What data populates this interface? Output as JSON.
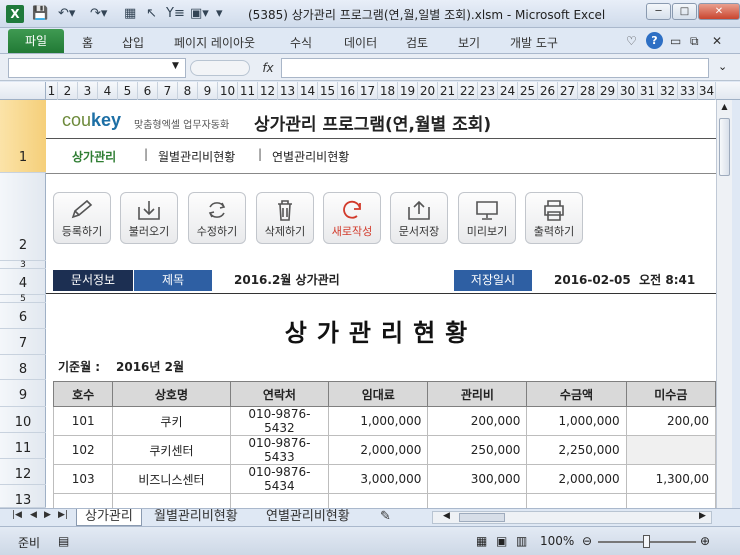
{
  "window": {
    "title": "(5385) 상가관리 프로그램(연,월,일별 조회).xlsm - Microsoft Excel",
    "min": "─",
    "max": "□",
    "close": "✕"
  },
  "ribbon": {
    "tabs": [
      "파일",
      "홈",
      "삽입",
      "페이지 레이아웃",
      "수식",
      "데이터",
      "검토",
      "보기",
      "개발 도구"
    ]
  },
  "formula_bar": {
    "name_box": "",
    "fx": "fx",
    "formula": ""
  },
  "columns": [
    "1",
    "2",
    "3",
    "4",
    "5",
    "6",
    "7",
    "8",
    "9",
    "10",
    "11",
    "12",
    "13",
    "14",
    "15",
    "16",
    "17",
    "18",
    "19",
    "20",
    "21",
    "22",
    "23",
    "24",
    "25",
    "26",
    "27",
    "28",
    "29",
    "30",
    "31",
    "32",
    "33",
    "34"
  ],
  "rows": [
    "1",
    "2",
    "3",
    "4",
    "5",
    "6",
    "7",
    "8",
    "9",
    "10",
    "11",
    "12",
    "13"
  ],
  "brand": {
    "cou": "cou",
    "key": "key",
    "subtitle": "맞춤형엑셀 업무자동화",
    "app_title": "상가관리 프로그램(연,월별 조회)"
  },
  "menu": {
    "items": [
      "상가관리",
      "월별관리비현황",
      "연별관리비현황"
    ],
    "active_color": "#2e7d32"
  },
  "toolbar": {
    "buttons": [
      "등록하기",
      "불러오기",
      "수정하기",
      "삭제하기",
      "새로작성",
      "문서저장",
      "미리보기",
      "출력하기"
    ],
    "icons": [
      "pencil-icon",
      "download-icon",
      "refresh-icon",
      "trash-icon",
      "new-icon",
      "upload-icon",
      "monitor-icon",
      "printer-icon"
    ]
  },
  "info": {
    "doc_info": "문서정보",
    "title_label": "제목",
    "title_value": "2016.2월 상가관리",
    "saved_label": "저장일시",
    "saved_value": "2016-02-05  오전 8:41"
  },
  "report": {
    "title": "상가관리현황",
    "month_label": "기준월 :",
    "month_value": "2016년 2월"
  },
  "table": {
    "headers": [
      "호수",
      "상호명",
      "연락처",
      "임대료",
      "관리비",
      "수금액",
      "미수금"
    ],
    "rows": [
      [
        "101",
        "쿠키",
        "010-9876-5432",
        "1,000,000",
        "200,000",
        "1,000,000",
        "200,00"
      ],
      [
        "102",
        "쿠키센터",
        "010-9876-5433",
        "2,000,000",
        "250,000",
        "2,250,000",
        ""
      ],
      [
        "103",
        "비즈니스센터",
        "010-9876-5434",
        "3,000,000",
        "300,000",
        "2,000,000",
        "1,300,00"
      ],
      [
        "",
        "",
        "",
        "",
        "",
        "",
        ""
      ]
    ]
  },
  "sheet_tabs": [
    "상가관리",
    "월별관리비현황",
    "연별관리비현황"
  ],
  "status": {
    "ready": "준비",
    "zoom": "100%"
  },
  "colors": {
    "navy": "#1c2f52",
    "blue": "#2e5fa3",
    "excel_green": "#217a35"
  }
}
